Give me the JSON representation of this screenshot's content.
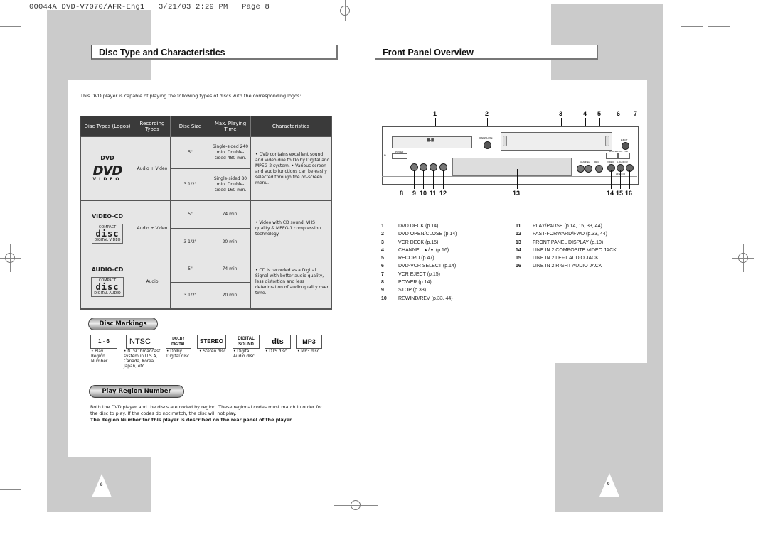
{
  "print_header": "00044A DVD-V7070/AFR-Eng1   3/21/03 2:29 PM   Page 8",
  "left_page": {
    "section_title": "Disc Type and Characteristics",
    "intro": "This DVD player is capable of playing the following types of discs with the corresponding logos:",
    "table": {
      "headers": [
        "Disc Types (Logos)",
        "Recording Types",
        "Disc Size",
        "Max. Playing Time",
        "Characteristics"
      ],
      "rows": [
        {
          "type": "DVD",
          "logo": "DVD VIDEO",
          "recording": "Audio + Video",
          "sizes": [
            {
              "size": "5\"",
              "time": "Single-sided 240 min. Double-sided 480 min."
            },
            {
              "size": "3 1/2\"",
              "time": "Single-sided 80 min. Double-sided 160 min."
            }
          ],
          "characteristics": "• DVD contains excellent sound and video due to Dolby Digital and MPEG-2 system. • Various screen and audio functions can be easily selected through the on-screen menu."
        },
        {
          "type": "VIDEO-CD",
          "logo": "COMPACT disc DIGITAL VIDEO",
          "recording": "Audio + Video",
          "sizes": [
            {
              "size": "5\"",
              "time": "74 min."
            },
            {
              "size": "3 1/2\"",
              "time": "20 min."
            }
          ],
          "characteristics": "• Video with CD sound, VHS quality & MPEG-1 compression technology."
        },
        {
          "type": "AUDIO-CD",
          "logo": "COMPACT disc DIGITAL AUDIO",
          "recording": "Audio",
          "sizes": [
            {
              "size": "5\"",
              "time": "74 min."
            },
            {
              "size": "3 1/2\"",
              "time": "20 min."
            }
          ],
          "characteristics": "• CD is recorded as a Digital Signal with better audio quality, less distortion and less deterioration of audio quality over time."
        }
      ]
    },
    "disc_markings": {
      "title": "Disc Markings",
      "items": [
        {
          "logo": "1 - 6",
          "desc": "• Play Region Number"
        },
        {
          "logo": "NTSC",
          "desc": "• NTSC broadcast system in U.S.A, Canada, Korea, Japan, etc."
        },
        {
          "logo": "DOLBY DIGITAL",
          "desc": "• Dolby Digital disc"
        },
        {
          "logo": "STEREO",
          "desc": "• Stereo disc"
        },
        {
          "logo": "DIGITAL SOUND",
          "desc": "• Digital Audio disc"
        },
        {
          "logo": "dts",
          "desc": "• DTS disc"
        },
        {
          "logo": "MP3",
          "desc": "• MP3 disc"
        }
      ]
    },
    "play_region": {
      "title": "Play Region Number",
      "text": "Both the DVD player and the discs are coded by region. These regional codes must match in order for the disc to play. If the codes do not match, the disc will not play.",
      "bold_text": "The Region Number for this player is described on the rear panel of the player."
    },
    "page_number": "8"
  },
  "right_page": {
    "section_title": "Front Panel Overview",
    "callouts_top": [
      "1",
      "2",
      "3",
      "4",
      "5",
      "6",
      "7"
    ],
    "callouts_bottom": [
      "8",
      "9",
      "10",
      "11",
      "12",
      "13",
      "14",
      "15",
      "16"
    ],
    "panel_labels": {
      "open_close": "OPEN/CLOSE",
      "power": "POWER",
      "eject": "EJECT",
      "channel": "CHANNEL",
      "rec": "REC",
      "select": "DVD SELECT VCR",
      "video": "VIDEO",
      "audio": "L AUDIO R",
      "line_in": "LINE IN 2"
    },
    "parts": [
      {
        "num": "1",
        "label": "DVD DECK (p.14)"
      },
      {
        "num": "2",
        "label": "DVD OPEN/CLOSE (p.14)"
      },
      {
        "num": "3",
        "label": "VCR DECK (p.15)"
      },
      {
        "num": "4",
        "label": "CHANNEL ▲/▼ (p.16)"
      },
      {
        "num": "5",
        "label": "RECORD (p.47)"
      },
      {
        "num": "6",
        "label": "DVD-VCR SELECT (p.14)"
      },
      {
        "num": "7",
        "label": "VCR EJECT (p.15)"
      },
      {
        "num": "8",
        "label": "POWER (p.14)"
      },
      {
        "num": "9",
        "label": "STOP (p.33)"
      },
      {
        "num": "10",
        "label": "REWIND/REV (p.33, 44)"
      },
      {
        "num": "11",
        "label": "PLAY/PAUSE (p.14, 15, 33, 44)"
      },
      {
        "num": "12",
        "label": "FAST-FORWARD/FWD (p.33, 44)"
      },
      {
        "num": "13",
        "label": "FRONT PANEL DISPLAY (p.10)"
      },
      {
        "num": "14",
        "label": "LINE IN 2 COMPOSITE VIDEO JACK"
      },
      {
        "num": "15",
        "label": "LINE IN 2 LEFT AUDIO JACK"
      },
      {
        "num": "16",
        "label": "LINE IN 2 RIGHT AUDIO JACK"
      }
    ],
    "page_number": "9"
  }
}
